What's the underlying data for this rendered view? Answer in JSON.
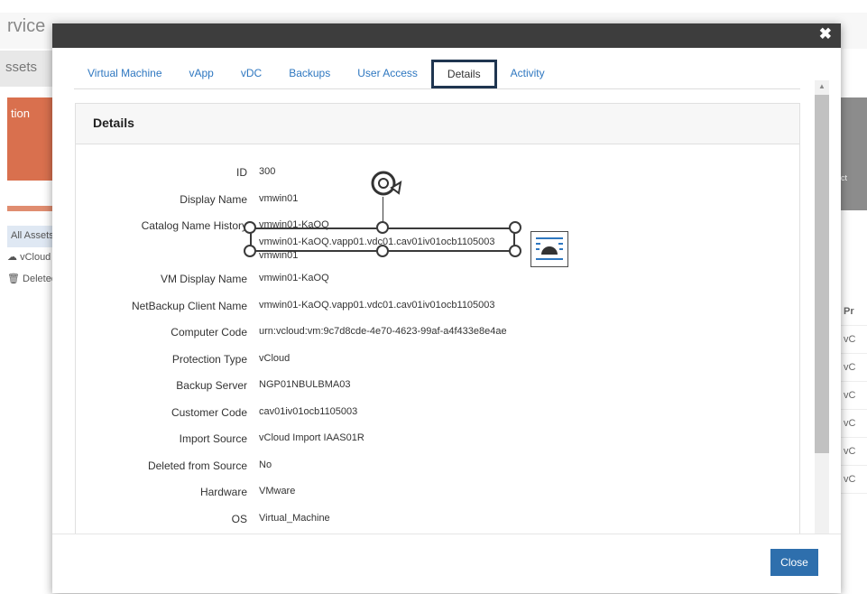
{
  "background": {
    "title_fragment": "rvice",
    "assets_tab": "ssets",
    "orange_card_label": "tion",
    "side_items": [
      "All Assets",
      "vCloud",
      "Deleted"
    ],
    "right_header": "Pr",
    "right_cells": [
      "vC",
      "vC",
      "vC",
      "vC",
      "vC",
      "vC"
    ],
    "right_gray_label": "ct"
  },
  "modal": {
    "close_x": "✖",
    "tabs": [
      {
        "label": "Virtual Machine",
        "active": false
      },
      {
        "label": "vApp",
        "active": false
      },
      {
        "label": "vDC",
        "active": false
      },
      {
        "label": "Backups",
        "active": false
      },
      {
        "label": "User Access",
        "active": false
      },
      {
        "label": "Details",
        "active": true
      },
      {
        "label": "Activity",
        "active": false
      }
    ],
    "panel_title": "Details",
    "fields": [
      {
        "label": "ID",
        "value": "300"
      },
      {
        "label": "Display Name",
        "value": "vmwin01"
      },
      {
        "label": "Catalog Name History",
        "value": "vmwin01-KaOQ"
      },
      {
        "label": "",
        "value": ""
      },
      {
        "label": "VM Display Name",
        "value": "vmwin01-KaOQ"
      },
      {
        "label": "NetBackup Client Name",
        "value": "vmwin01-KaOQ.vapp01.vdc01.cav01iv01ocb1105003"
      },
      {
        "label": "Computer Code",
        "value": "urn:vcloud:vm:9c7d8cde-4e70-4623-99af-a4f433e8e4ae"
      },
      {
        "label": "Protection Type",
        "value": "vCloud"
      },
      {
        "label": "Backup Server",
        "value": "NGP01NBULBMA03"
      },
      {
        "label": "Customer Code",
        "value": "cav01iv01ocb1105003"
      },
      {
        "label": "Import Source",
        "value": "vCloud Import IAAS01R"
      },
      {
        "label": "Deleted from Source",
        "value": "No"
      },
      {
        "label": "Hardware",
        "value": "VMware"
      },
      {
        "label": "OS",
        "value": "Virtual_Machine"
      }
    ],
    "selected_text": "vmwin01-KaOQ.vapp01.vdc01.cav01iv01ocb1105003",
    "selected_text_below": "vmwin01",
    "close_button": "Close"
  },
  "colors": {
    "accent": "#2e6fad",
    "tab_link": "#2e77c0",
    "header_bar": "#3d3d3d",
    "active_tab_border": "#1f3550",
    "orange": "#d9704e"
  }
}
